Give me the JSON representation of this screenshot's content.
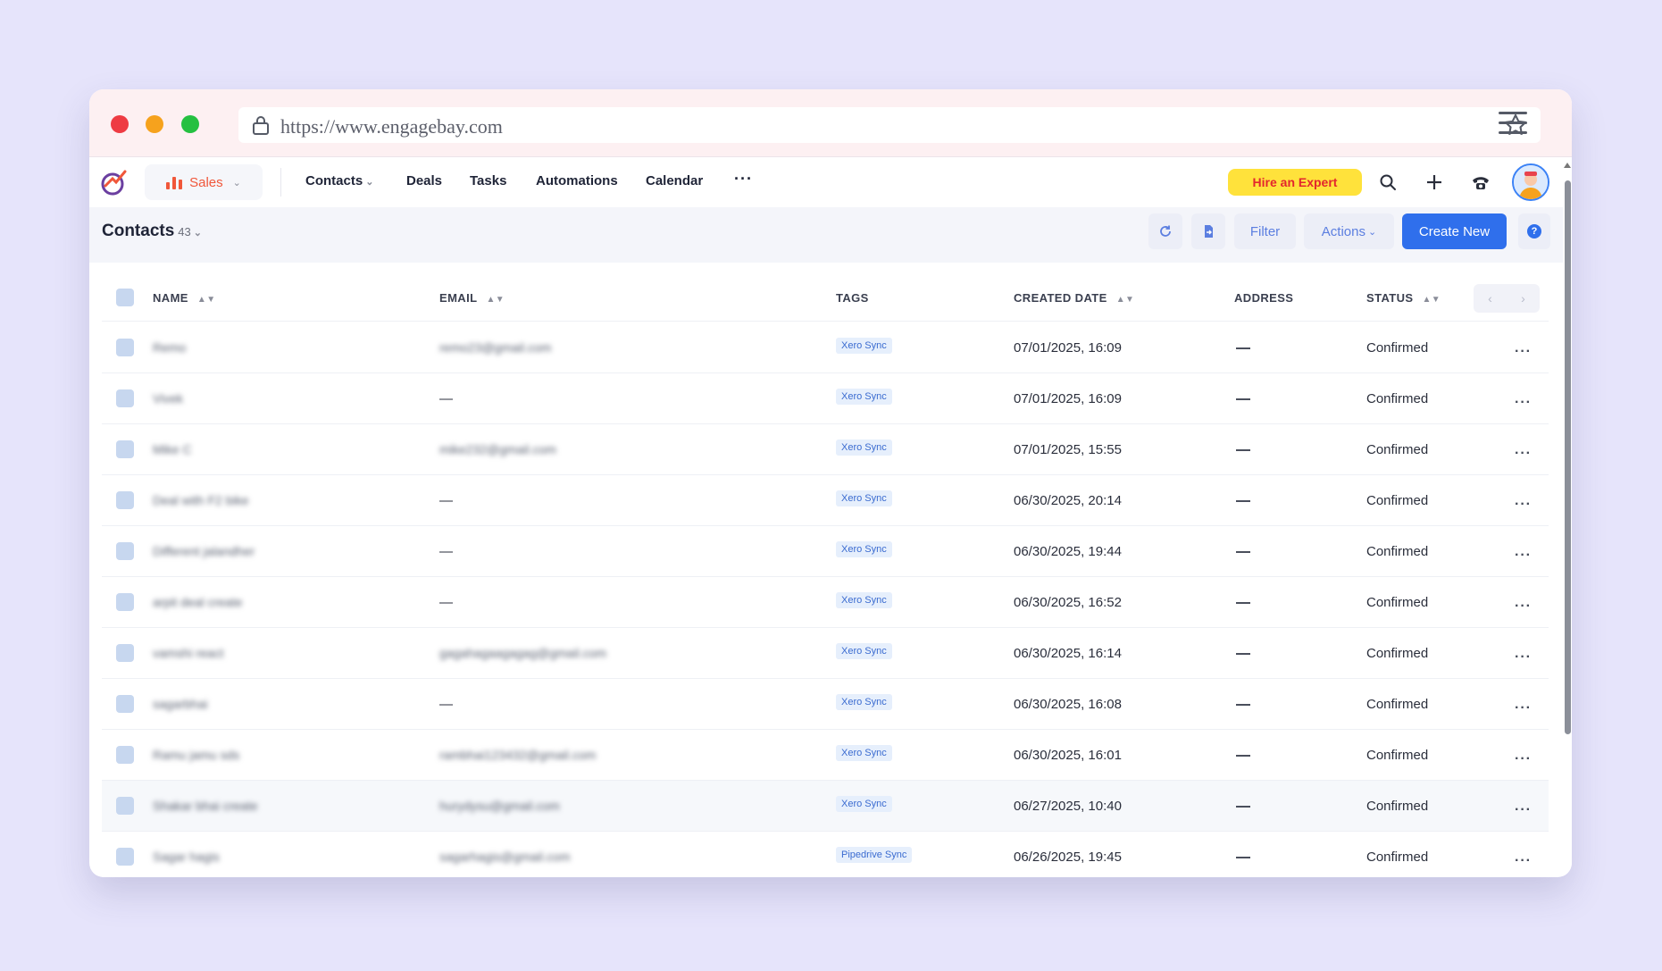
{
  "browser": {
    "url": "https://www.engagebay.com"
  },
  "nav": {
    "module": "Sales",
    "items": [
      "Contacts",
      "Deals",
      "Tasks",
      "Automations",
      "Calendar"
    ],
    "hire_label": "Hire an Expert"
  },
  "page": {
    "title": "Contacts",
    "count": "43",
    "filter_label": "Filter",
    "actions_label": "Actions",
    "create_label": "Create New",
    "help_label": "?"
  },
  "table": {
    "columns": [
      "NAME",
      "EMAIL",
      "TAGS",
      "CREATED DATE",
      "ADDRESS",
      "STATUS"
    ],
    "rows": [
      {
        "name": "Remo",
        "email": "remo23@gmail.com",
        "tag": "Xero Sync",
        "created": "07/01/2025, 16:09",
        "address": "",
        "status": "Confirmed"
      },
      {
        "name": "Vivek",
        "email": "—",
        "tag": "Xero Sync",
        "created": "07/01/2025, 16:09",
        "address": "",
        "status": "Confirmed"
      },
      {
        "name": "Mike C",
        "email": "mike232@gmail.com",
        "tag": "Xero Sync",
        "created": "07/01/2025, 15:55",
        "address": "",
        "status": "Confirmed"
      },
      {
        "name": "Deal with F2 bike",
        "email": "—",
        "tag": "Xero Sync",
        "created": "06/30/2025, 20:14",
        "address": "",
        "status": "Confirmed"
      },
      {
        "name": "Different jalandher",
        "email": "—",
        "tag": "Xero Sync",
        "created": "06/30/2025, 19:44",
        "address": "",
        "status": "Confirmed"
      },
      {
        "name": "arpit deal create",
        "email": "—",
        "tag": "Xero Sync",
        "created": "06/30/2025, 16:52",
        "address": "",
        "status": "Confirmed"
      },
      {
        "name": "vamshi react",
        "email": "gagahagaagagag@gmail.com",
        "tag": "Xero Sync",
        "created": "06/30/2025, 16:14",
        "address": "",
        "status": "Confirmed"
      },
      {
        "name": "sagarbhai",
        "email": "—",
        "tag": "Xero Sync",
        "created": "06/30/2025, 16:08",
        "address": "",
        "status": "Confirmed"
      },
      {
        "name": "Ramu jamu sds",
        "email": "rambhai123432@gmail.com",
        "tag": "Xero Sync",
        "created": "06/30/2025, 16:01",
        "address": "",
        "status": "Confirmed"
      },
      {
        "name": "Shakar bhai create",
        "email": "hurydysu@gmail.com",
        "tag": "Xero Sync",
        "created": "06/27/2025, 10:40",
        "address": "",
        "status": "Confirmed"
      },
      {
        "name": "Sagar hagis",
        "email": "sagarhagis@gmail.com",
        "tag": "Pipedrive Sync",
        "created": "06/26/2025, 19:45",
        "address": "",
        "status": "Confirmed"
      }
    ]
  },
  "colors": {
    "background": "#e6e4fb",
    "accent": "#2f6fec",
    "sales": "#f0573a",
    "hire": "#ffe23b"
  }
}
